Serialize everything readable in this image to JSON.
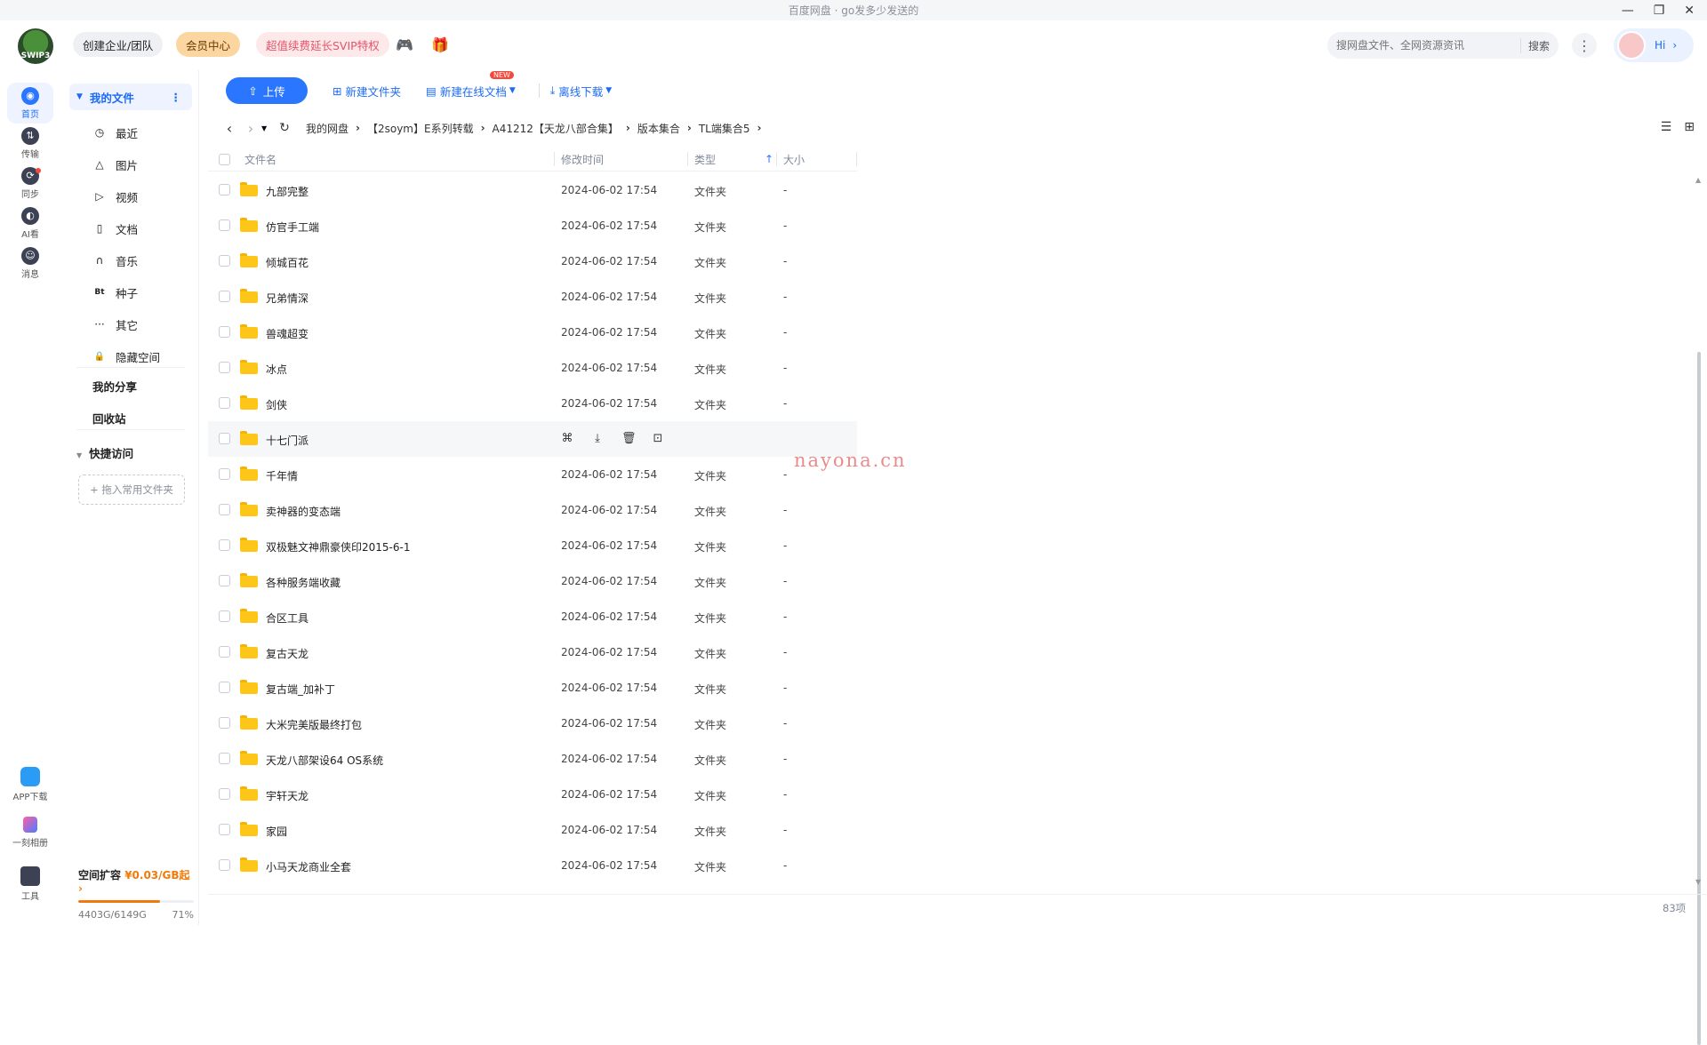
{
  "window": {
    "title": "百度网盘 · go发多少发送的"
  },
  "header": {
    "logo_text": "SWIP3",
    "team_btn": "创建企业/团队",
    "vip_btn": "会员中心",
    "svip_btn": "超值续费延长SVIP特权",
    "search_placeholder": "搜网盘文件、全网资源资讯",
    "search_btn": "搜索",
    "avatar_hi": "Hi"
  },
  "nav": [
    {
      "label": "首页",
      "icon": "home-icon",
      "glyph": "◉"
    },
    {
      "label": "传输",
      "icon": "transfer-icon",
      "glyph": "⇅"
    },
    {
      "label": "同步",
      "icon": "sync-icon",
      "glyph": "⟳"
    },
    {
      "label": "AI看",
      "icon": "ai-icon",
      "glyph": "◐"
    },
    {
      "label": "消息",
      "icon": "message-icon",
      "glyph": "☺"
    }
  ],
  "nav_bottom": [
    {
      "label": "APP下载",
      "icon": "app-download-icon"
    },
    {
      "label": "一刻相册",
      "icon": "album-icon"
    },
    {
      "label": "工具",
      "icon": "tools-icon"
    }
  ],
  "sidebar": {
    "my_files": "我的文件",
    "items": [
      {
        "label": "最近",
        "icon": "clock-icon",
        "glyph": "◷"
      },
      {
        "label": "图片",
        "icon": "image-icon",
        "glyph": "△"
      },
      {
        "label": "视频",
        "icon": "video-icon",
        "glyph": "▷"
      },
      {
        "label": "文档",
        "icon": "document-icon",
        "glyph": "▯"
      },
      {
        "label": "音乐",
        "icon": "music-icon",
        "glyph": "∩"
      },
      {
        "label": "种子",
        "icon": "torrent-icon",
        "glyph": "Bt"
      },
      {
        "label": "其它",
        "icon": "other-icon",
        "glyph": "···"
      },
      {
        "label": "隐藏空间",
        "icon": "lock-icon",
        "glyph": "🔒"
      }
    ],
    "my_share": "我的分享",
    "recycle": "回收站",
    "quick_access": "快捷访问",
    "drop_hint": "+ 拖入常用文件夹",
    "storage_title": "空间扩容",
    "storage_promo": "¥0.03/GB起",
    "storage_used": "4403G/6149G",
    "storage_percent": "71%",
    "storage_fraction": 0.71
  },
  "toolbar": {
    "upload": "上传",
    "new_folder": "新建文件夹",
    "new_doc": "新建在线文档",
    "new_badge": "NEW",
    "offline": "离线下载"
  },
  "breadcrumb": [
    "我的网盘",
    "【2soym】E系列转载",
    "A41212【天龙八部合集】",
    "版本集合",
    "TL端集合5"
  ],
  "table": {
    "col_name": "文件名",
    "col_time": "修改时间",
    "col_type": "类型",
    "col_size": "大小",
    "rows": [
      {
        "name": "九部完整",
        "time": "2024-06-02 17:54",
        "type": "文件夹",
        "size": "-"
      },
      {
        "name": "仿官手工端",
        "time": "2024-06-02 17:54",
        "type": "文件夹",
        "size": "-"
      },
      {
        "name": "倾城百花",
        "time": "2024-06-02 17:54",
        "type": "文件夹",
        "size": "-"
      },
      {
        "name": "兄弟情深",
        "time": "2024-06-02 17:54",
        "type": "文件夹",
        "size": "-"
      },
      {
        "name": "兽魂超变",
        "time": "2024-06-02 17:54",
        "type": "文件夹",
        "size": "-"
      },
      {
        "name": "冰点",
        "time": "2024-06-02 17:54",
        "type": "文件夹",
        "size": "-"
      },
      {
        "name": "剑侠",
        "time": "2024-06-02 17:54",
        "type": "文件夹",
        "size": "-"
      },
      {
        "name": "十七门派",
        "time": "",
        "type": "",
        "size": "",
        "hover": true
      },
      {
        "name": "千年情",
        "time": "2024-06-02 17:54",
        "type": "文件夹",
        "size": "-"
      },
      {
        "name": "卖神器的变态端",
        "time": "2024-06-02 17:54",
        "type": "文件夹",
        "size": "-"
      },
      {
        "name": "双极魅文神鼎豪侠印2015-6-1",
        "time": "2024-06-02 17:54",
        "type": "文件夹",
        "size": "-"
      },
      {
        "name": "各种服务端收藏",
        "time": "2024-06-02 17:54",
        "type": "文件夹",
        "size": "-"
      },
      {
        "name": "合区工具",
        "time": "2024-06-02 17:54",
        "type": "文件夹",
        "size": "-"
      },
      {
        "name": "复古天龙",
        "time": "2024-06-02 17:54",
        "type": "文件夹",
        "size": "-"
      },
      {
        "name": "复古端_加补丁",
        "time": "2024-06-02 17:54",
        "type": "文件夹",
        "size": "-"
      },
      {
        "name": "大米完美版最终打包",
        "time": "2024-06-02 17:54",
        "type": "文件夹",
        "size": "-"
      },
      {
        "name": "天龙八部架设64  OS系统",
        "time": "2024-06-02 17:54",
        "type": "文件夹",
        "size": "-"
      },
      {
        "name": "宇轩天龙",
        "time": "2024-06-02 17:54",
        "type": "文件夹",
        "size": "-"
      },
      {
        "name": "家园",
        "time": "2024-06-02 17:54",
        "type": "文件夹",
        "size": "-"
      },
      {
        "name": "小马天龙商业全套",
        "time": "2024-06-02 17:54",
        "type": "文件夹",
        "size": "-"
      }
    ]
  },
  "watermark": "nayona.cn",
  "item_count": "83项",
  "colors": {
    "accent": "#2b76ff",
    "folder": "#ffc61a",
    "promo": "#f07b0b"
  }
}
